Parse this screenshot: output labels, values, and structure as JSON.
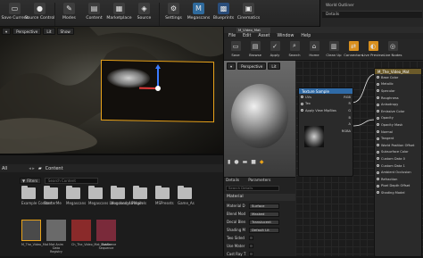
{
  "toolbar": {
    "buttons": [
      {
        "label": "Save Current",
        "icon": "save-icon"
      },
      {
        "label": "Source Control",
        "icon": "source-control-icon"
      },
      {
        "label": "Modes",
        "icon": "modes-icon"
      },
      {
        "label": "Content",
        "icon": "content-icon"
      },
      {
        "label": "Marketplace",
        "icon": "marketplace-icon"
      },
      {
        "label": "Source",
        "icon": "source-icon"
      },
      {
        "label": "Settings",
        "icon": "settings-icon"
      },
      {
        "label": "Megascans",
        "icon": "megascans-icon"
      },
      {
        "label": "Blueprints",
        "icon": "blueprints-icon"
      },
      {
        "label": "Cinematics",
        "icon": "cinematics-icon"
      }
    ]
  },
  "right_panel": {
    "world_outliner": "World Outliner",
    "details": "Details"
  },
  "viewport": {
    "perspective": "Perspective",
    "lit": "Lit",
    "show": "Show"
  },
  "content_browser": {
    "all": "All",
    "breadcrumb": "Content",
    "filters": "Filters",
    "search_placeholder": "Search Content",
    "folders": [
      "Example Content",
      "StarterMe",
      "Megascans",
      "Megascans Launched_Ab",
      "Megascans Plugin",
      "Models",
      "MSPresets",
      "Game_As"
    ],
    "assets": [
      {
        "label": "M_The_Video_Mat"
      },
      {
        "label": "Mat Anim Data Registry"
      },
      {
        "label": "Ch_The_Video_Mat_SubScene"
      },
      {
        "label": "Master Sequence"
      }
    ]
  },
  "material_editor": {
    "title": "M_Video_Mat",
    "menu": [
      "File",
      "Edit",
      "Asset",
      "Window",
      "Help"
    ],
    "toolbar": [
      {
        "label": "Save",
        "icon": "save-icon"
      },
      {
        "label": "Browse",
        "icon": "browse-icon"
      },
      {
        "label": "Apply",
        "icon": "apply-icon"
      },
      {
        "label": "Search",
        "icon": "search-icon"
      },
      {
        "label": "Home",
        "icon": "home-icon"
      },
      {
        "label": "Clean Up",
        "icon": "clean-up-icon"
      },
      {
        "label": "Connectors",
        "icon": "connectors-icon"
      },
      {
        "label": "Live Preview",
        "icon": "live-preview-icon"
      },
      {
        "label": "Live Nodes",
        "icon": "live-nodes-icon"
      }
    ],
    "viewport": {
      "perspective": "Perspective",
      "lit": "Lit"
    },
    "texture_node": {
      "title": "Texture Sample",
      "pins_in": [
        "UVs",
        "Tex",
        "Apply View MipBias"
      ],
      "pins_out": [
        "RGB",
        "R",
        "G",
        "B",
        "A",
        "RGBA"
      ]
    },
    "result_node": {
      "title": "M_The_Video_Mat",
      "pins": [
        "Base Color",
        "Metallic",
        "Specular",
        "Roughness",
        "Anisotropy",
        "Emissive Color",
        "Opacity",
        "Opacity Mask",
        "Normal",
        "Tangent",
        "World Position Offset",
        "Subsurface Color",
        "Custom Data 0",
        "Custom Data 1",
        "Ambient Occlusion",
        "Refraction",
        "Pixel Depth Offset",
        "Shading Model"
      ]
    },
    "details": {
      "tab_details": "Details",
      "tab_params": "Parameters",
      "search_placeholder": "Search Details",
      "section": "Material",
      "rows": [
        {
          "label": "Material D",
          "value": "Surface"
        },
        {
          "label": "Blend Mod",
          "value": "Masked"
        },
        {
          "label": "Decal Blen",
          "value": "Translucent"
        },
        {
          "label": "Shading M",
          "value": "Default Lit"
        },
        {
          "label": "Two Sided",
          "value": ""
        },
        {
          "label": "Use Mater",
          "value": ""
        },
        {
          "label": "Cast Ray T",
          "value": ""
        }
      ]
    }
  }
}
